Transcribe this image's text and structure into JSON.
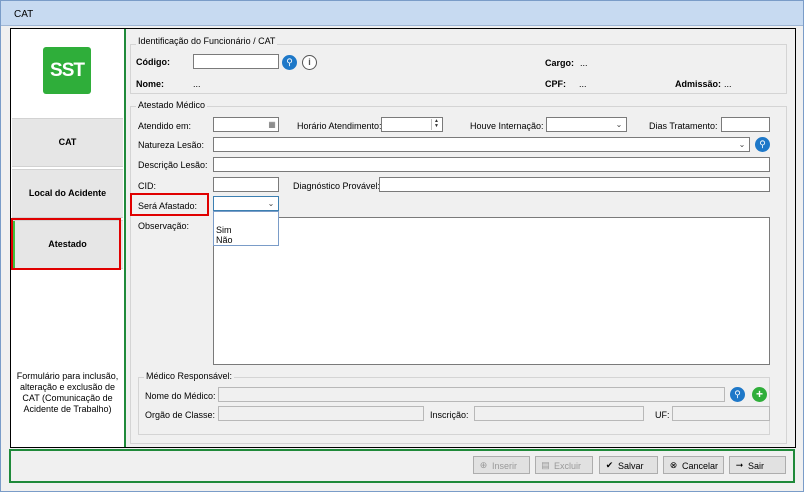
{
  "window": {
    "title": "CAT"
  },
  "logo": {
    "text": "SST"
  },
  "nav": {
    "items": [
      {
        "label": "CAT"
      },
      {
        "label": "Local do Acidente"
      },
      {
        "label": "Atestado"
      }
    ],
    "description": "Formulário para inclusão, alteração e exclusão de CAT (Comunicação de Acidente de Trabalho)"
  },
  "funcionario": {
    "title": "Identificação do Funcionário / CAT",
    "codigo_label": "Código:",
    "codigo_value": "",
    "nome_label": "Nome:",
    "nome_value": "...",
    "cargo_label": "Cargo:",
    "cargo_value": "...",
    "cpf_label": "CPF:",
    "cpf_value": "...",
    "admissao_label": "Admissão:",
    "admissao_value": "..."
  },
  "atestado": {
    "title": "Atestado Médico",
    "atendido_label": "Atendido em:",
    "atendido_value": "",
    "horario_label": "Horário Atendimento:",
    "horario_value": "",
    "internacao_label": "Houve Internação:",
    "internacao_value": "",
    "dias_label": "Dias Tratamento:",
    "dias_value": "",
    "natureza_label": "Natureza Lesão:",
    "natureza_value": "",
    "descricao_label": "Descrição Lesão:",
    "descricao_value": "",
    "cid_label": "CID:",
    "cid_value": "",
    "diagnostico_label": "Diagnóstico Provável:",
    "diagnostico_value": "",
    "afastado_label": "Será Afastado:",
    "afastado_value": "",
    "afastado_options": [
      "Sim",
      "Não"
    ],
    "observacao_label": "Observação:",
    "observacao_value": ""
  },
  "medico": {
    "title": "Médico Responsável:",
    "nome_label": "Nome do Médico:",
    "orgao_label": "Orgão de Classe:",
    "inscricao_label": "Inscrição:",
    "uf_label": "UF:"
  },
  "buttons": {
    "inserir": "Inserir",
    "excluir": "Excluir",
    "salvar": "Salvar",
    "cancelar": "Cancelar",
    "sair": "Sair"
  },
  "colors": {
    "accent_green": "#1f8a3a",
    "logo_green": "#2fae3a",
    "highlight_red": "#e00000",
    "search_blue": "#1e78c8"
  }
}
